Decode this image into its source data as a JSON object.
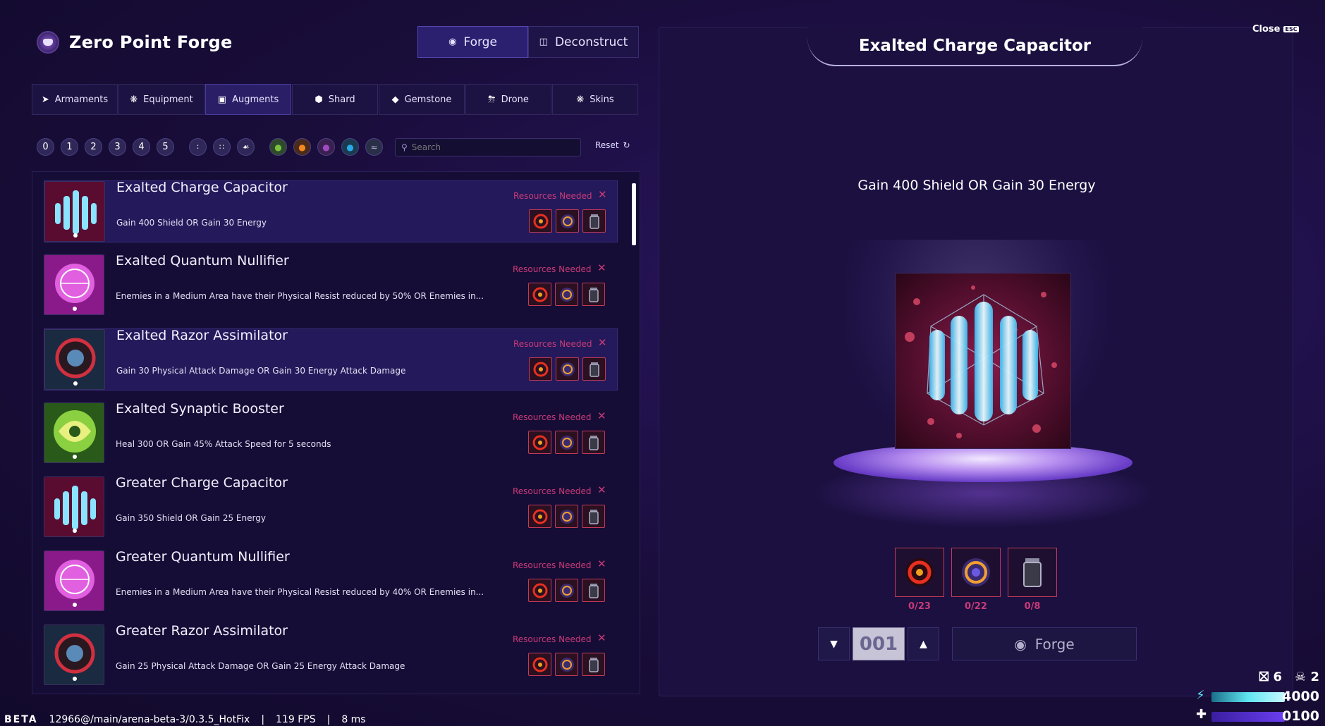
{
  "app": {
    "title": "Zero Point Forge"
  },
  "mode_tabs": [
    {
      "label": "Forge",
      "icon": "forge-icon",
      "active": true
    },
    {
      "label": "Deconstruct",
      "icon": "deconstruct-icon",
      "active": false
    }
  ],
  "category_tabs": [
    {
      "label": "Armaments",
      "icon": "armaments-icon",
      "active": false
    },
    {
      "label": "Equipment",
      "icon": "equipment-icon",
      "active": false
    },
    {
      "label": "Augments",
      "icon": "augments-icon",
      "active": true
    },
    {
      "label": "Shard",
      "icon": "shard-icon",
      "active": false
    },
    {
      "label": "Gemstone",
      "icon": "gemstone-icon",
      "active": false
    },
    {
      "label": "Drone",
      "icon": "drone-icon",
      "active": false
    },
    {
      "label": "Skins",
      "icon": "skins-icon",
      "active": false
    }
  ],
  "filters": {
    "tiers": [
      "0",
      "1",
      "2",
      "3",
      "4",
      "5"
    ],
    "groups": [
      "group-small-icon",
      "group-medium-icon",
      "group-large-icon"
    ],
    "elements": [
      {
        "name": "nature-element-icon",
        "color": "#7ac043"
      },
      {
        "name": "fire-element-icon",
        "color": "#f08a20"
      },
      {
        "name": "arcane-element-icon",
        "color": "#a04ac0"
      },
      {
        "name": "water-element-icon",
        "color": "#2aa8e8"
      },
      {
        "name": "wind-element-icon",
        "color": "#7a8ab0"
      }
    ],
    "search_placeholder": "Search",
    "reset_label": "Reset"
  },
  "list": {
    "resources_label": "Resources Needed",
    "items": [
      {
        "name": "Exalted Charge Capacitor",
        "desc": "Gain 400 Shield OR Gain 30 Energy",
        "thumb": "capacitor",
        "highlighted": true
      },
      {
        "name": "Exalted Quantum Nullifier",
        "desc": "Enemies in a Medium Area have their Physical Resist reduced by 50% OR Enemies in...",
        "thumb": "nullifier",
        "highlighted": false
      },
      {
        "name": "Exalted Razor Assimilator",
        "desc": "Gain 30 Physical Attack Damage OR Gain 30 Energy Attack Damage",
        "thumb": "razor",
        "highlighted": true
      },
      {
        "name": "Exalted Synaptic Booster",
        "desc": "Heal 300 OR Gain 45% Attack Speed for 5 seconds",
        "thumb": "booster",
        "highlighted": false
      },
      {
        "name": "Greater Charge Capacitor",
        "desc": "Gain 350 Shield OR Gain 25 Energy",
        "thumb": "capacitor",
        "highlighted": false
      },
      {
        "name": "Greater Quantum Nullifier",
        "desc": "Enemies in a Medium Area have their Physical Resist reduced by 40% OR Enemies in...",
        "thumb": "nullifier",
        "highlighted": false
      },
      {
        "name": "Greater Razor Assimilator",
        "desc": "Gain 25 Physical Attack Damage OR Gain 25 Energy Attack Damage",
        "thumb": "razor",
        "highlighted": false
      }
    ]
  },
  "detail": {
    "title": "Exalted Charge Capacitor",
    "close_label": "Close",
    "close_key": "ESC",
    "description": "Gain 400 Shield OR Gain 30 Energy",
    "costs": [
      {
        "icon": "fire-orb-resource-icon",
        "amount": "0/23"
      },
      {
        "icon": "arcane-orb-resource-icon",
        "amount": "0/22"
      },
      {
        "icon": "canister-resource-icon",
        "amount": "0/8"
      }
    ],
    "quantity": "001",
    "forge_label": "Forge"
  },
  "statusbar": {
    "beta": "BETA",
    "build": "12966@/main/arena-beta-3/0.3.5_HotFix",
    "sep1": "|",
    "fps": "119 FPS",
    "sep2": "|",
    "latency": "8 ms"
  },
  "hud": {
    "count_a": "6",
    "count_b": "2",
    "energy": "4000",
    "health": "0100",
    "energy_color": "#5fe6f0",
    "health_color": "#6a3ef0"
  }
}
